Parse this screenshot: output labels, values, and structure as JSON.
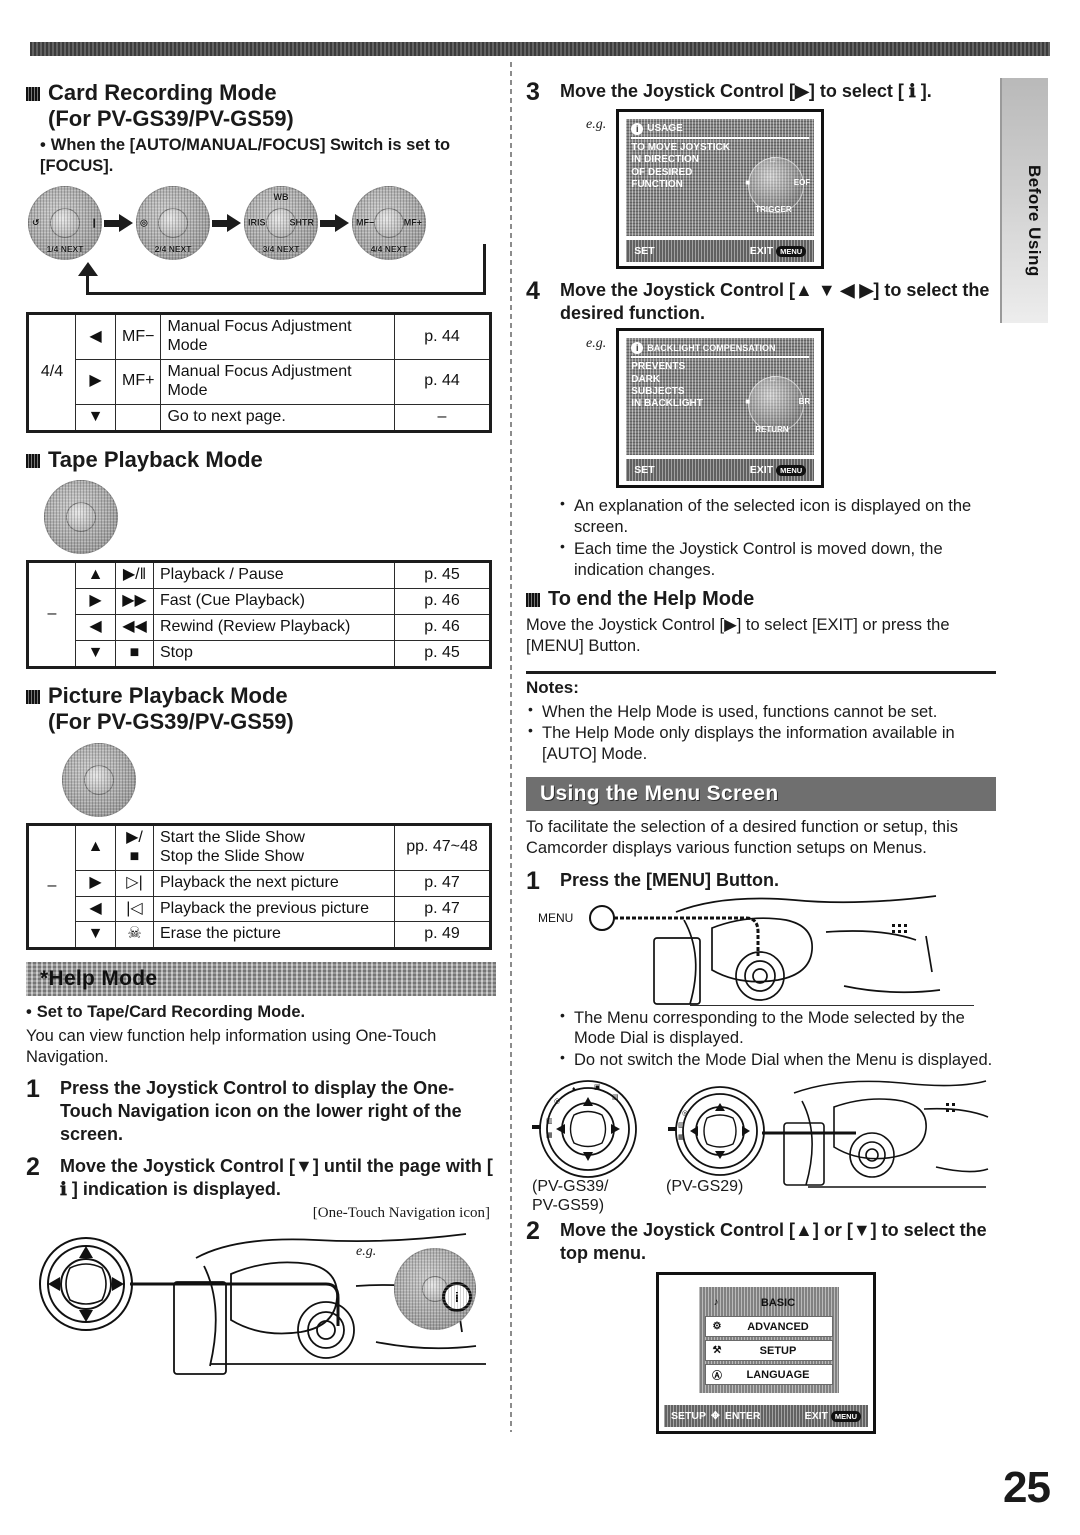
{
  "page": {
    "number": "25",
    "side_tab": "Before Using"
  },
  "left": {
    "card_rec": {
      "title": "Card Recording Mode",
      "subtitle": "(For PV-GS39/PV-GS59)",
      "note": "When the [AUTO/MANUAL/FOCUS] Switch is set to [FOCUS].",
      "joysticks": [
        {
          "top": "",
          "left": "↺",
          "right": "❙",
          "bottom": "1/4 NEXT"
        },
        {
          "top": "",
          "left": "◎",
          "right": "",
          "bottom": "2/4 NEXT"
        },
        {
          "top": "WB",
          "left": "IRIS",
          "right": "SHTR",
          "bottom": "3/4 NEXT"
        },
        {
          "top": "",
          "left": "MF−",
          "right": "MF+",
          "bottom": "4/4 NEXT"
        }
      ],
      "table": {
        "page_label": "4/4",
        "rows": [
          {
            "dir": "◀",
            "icon": "MF−",
            "desc": "Manual Focus Adjustment Mode",
            "ref": "p. 44"
          },
          {
            "dir": "▶",
            "icon": "MF+",
            "desc": "Manual Focus Adjustment Mode",
            "ref": "p. 44"
          },
          {
            "dir": "▼",
            "icon": "",
            "desc": "Go to next page.",
            "ref": "–"
          }
        ]
      }
    },
    "tape_playback": {
      "title": "Tape Playback Mode",
      "table": {
        "page_label": "–",
        "rows": [
          {
            "dir": "▲",
            "icon": "▶/‖",
            "desc": "Playback / Pause",
            "ref": "p. 45"
          },
          {
            "dir": "▶",
            "icon": "▶▶",
            "desc": "Fast (Cue Playback)",
            "ref": "p. 46"
          },
          {
            "dir": "◀",
            "icon": "◀◀",
            "desc": "Rewind (Review Playback)",
            "ref": "p. 46"
          },
          {
            "dir": "▼",
            "icon": "■",
            "desc": "Stop",
            "ref": "p. 45"
          }
        ]
      }
    },
    "picture_playback": {
      "title": "Picture Playback Mode",
      "subtitle": "(For PV-GS39/PV-GS59)",
      "table": {
        "page_label": "–",
        "rows": [
          {
            "dir": "▲",
            "icon": "▶/■",
            "desc": "Start the Slide Show\nStop the Slide Show",
            "ref": "pp. 47~48"
          },
          {
            "dir": "▶",
            "icon": "▷|",
            "desc": "Playback the next picture",
            "ref": "p. 47"
          },
          {
            "dir": "◀",
            "icon": "|◁",
            "desc": "Playback the previous picture",
            "ref": "p. 47"
          },
          {
            "dir": "▼",
            "icon": "☠",
            "desc": "Erase the picture",
            "ref": "p. 49"
          }
        ]
      }
    },
    "help_mode": {
      "band": "*Help Mode",
      "bullet": "Set to Tape/Card Recording Mode.",
      "intro": "You can view function help information using One-Touch Navigation.",
      "steps": [
        {
          "num": "1",
          "text": "Press the Joystick Control to display the One-Touch Navigation icon on the lower right of the screen."
        },
        {
          "num": "2",
          "text": "Move the Joystick Control [▼] until the page with [ ℹ ] indication is displayed."
        }
      ],
      "icon_caption": "[One-Touch Navigation icon]",
      "eg": "e.g."
    }
  },
  "right": {
    "step3": {
      "num": "3",
      "text": "Move the Joystick Control [▶] to select [ ℹ ].",
      "eg": "e.g.",
      "lcd": {
        "title": "USAGE",
        "lines": [
          "TO MOVE JOYSTICK",
          "IN DIRECTION",
          "OF DESIRED",
          "FUNCTION"
        ],
        "pad": {
          "left": "■",
          "right": "EOF",
          "bottom": "TRIGGER",
          "top": "□"
        },
        "set": "SET",
        "exit": "EXIT",
        "exitkey": "MENU"
      }
    },
    "step4": {
      "num": "4",
      "text": "Move the Joystick Control [▲ ▼ ◀ ▶] to select the desired function.",
      "eg": "e.g.",
      "lcd": {
        "title": "BACKLIGHT COMPENSATION",
        "lines": [
          "PREVENTS",
          "DARK",
          "SUBJECTS",
          "IN BACKLIGHT"
        ],
        "pad": {
          "left": "■",
          "right": "BR",
          "bottom": "RETURN",
          "top": "□"
        },
        "set": "SET",
        "exit": "EXIT",
        "exitkey": "MENU"
      }
    },
    "bullets_after_step4": [
      "An explanation of the selected icon is displayed on the screen.",
      "Each time the Joystick Control is moved down, the indication changes."
    ],
    "end_help": {
      "title": "To end the Help Mode",
      "text": "Move the Joystick Control [▶] to select [EXIT] or press the [MENU] Button."
    },
    "notes": {
      "title": "Notes:",
      "items": [
        "When the Help Mode is used, functions cannot be set.",
        "The Help Mode only displays the information available in [AUTO] Mode."
      ]
    },
    "menu_screen": {
      "band": "Using the Menu Screen",
      "intro": "To facilitate the selection of a desired function or setup, this Camcorder displays various function setups on Menus.",
      "step1": {
        "num": "1",
        "text": "Press the [MENU] Button.",
        "button_label": "MENU"
      },
      "bullets": [
        "The Menu corresponding to the Mode selected by the Mode Dial is displayed.",
        "Do not switch the Mode Dial when the Menu is displayed."
      ],
      "dial_captions": [
        "(PV-GS39/\nPV-GS59)",
        "(PV-GS29)"
      ],
      "step2": {
        "num": "2",
        "text": "Move the Joystick Control [▲] or [▼] to select the top menu."
      },
      "lcd": {
        "items": [
          {
            "icon": "♪",
            "label": "BASIC",
            "selected": true
          },
          {
            "icon": "⚙",
            "label": "ADVANCED",
            "selected": false
          },
          {
            "icon": "⚒",
            "label": "SETUP",
            "selected": false
          },
          {
            "icon": "Ⓐ",
            "label": "LANGUAGE",
            "selected": false
          }
        ],
        "setup": "SETUP",
        "enter": "ENTER",
        "exit": "EXIT",
        "exitkey": "MENU"
      }
    }
  }
}
